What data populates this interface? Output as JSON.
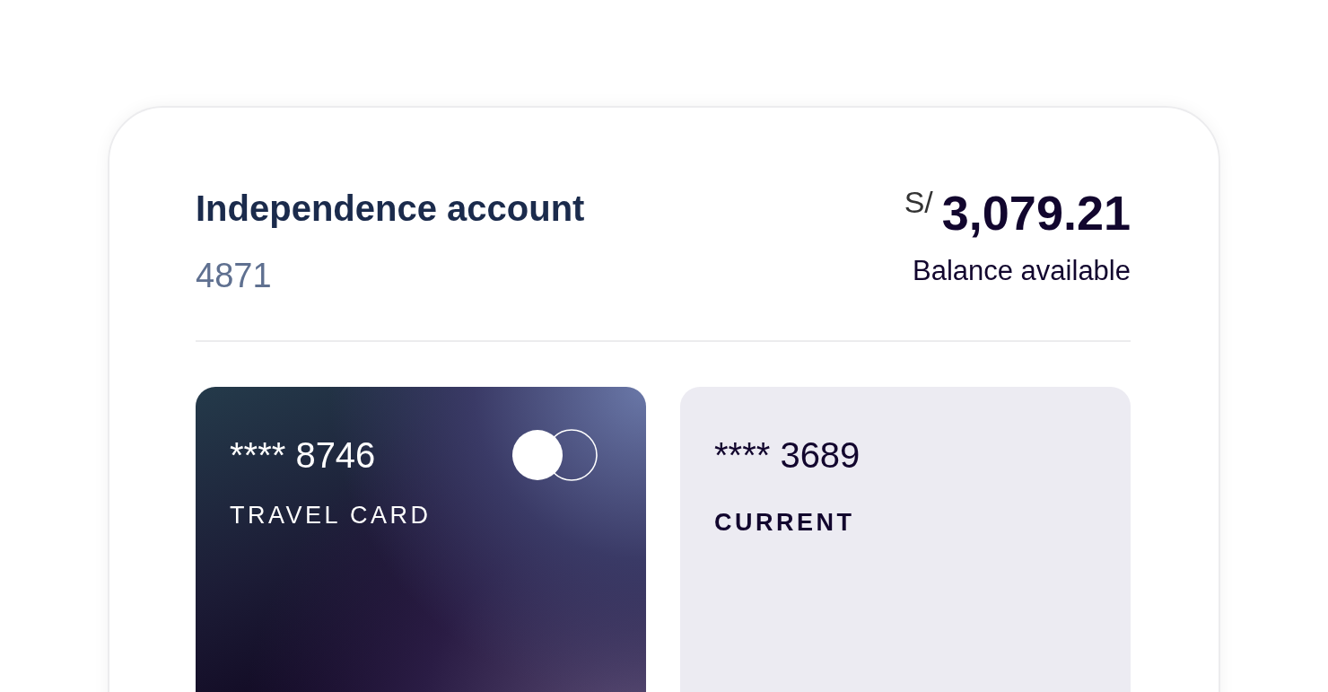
{
  "account": {
    "title": "Independence account",
    "number": "4871",
    "currency": "S/",
    "balance": "3,079.21",
    "balance_label": "Balance available"
  },
  "cards": [
    {
      "kind": "dark",
      "number": "**** 8746",
      "label": "TRAVEL CARD",
      "logo": true
    },
    {
      "kind": "light",
      "number": "**** 3689",
      "label": "CURRENT",
      "logo": false
    }
  ]
}
